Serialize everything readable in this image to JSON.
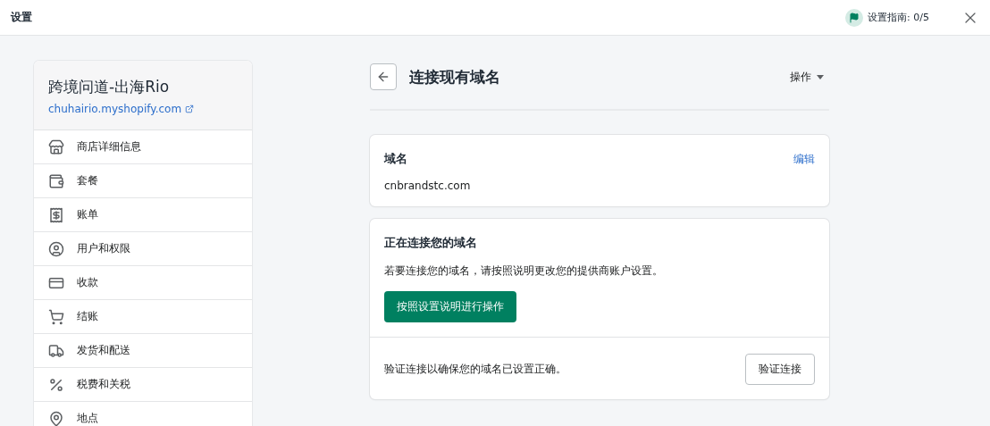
{
  "top_bar": {
    "title": "设置",
    "setup_guide": "设置指南: 0/5"
  },
  "sidebar": {
    "store_name": "跨境问道-出海Rio",
    "store_url": "chuhairio.myshopify.com",
    "items": [
      {
        "kind": "store",
        "label": "商店详细信息"
      },
      {
        "kind": "plan",
        "label": "套餐"
      },
      {
        "kind": "billing",
        "label": "账单"
      },
      {
        "kind": "users",
        "label": "用户和权限"
      },
      {
        "kind": "payments",
        "label": "收款"
      },
      {
        "kind": "checkout",
        "label": "结账"
      },
      {
        "kind": "shipping",
        "label": "发货和配送"
      },
      {
        "kind": "taxes",
        "label": "税费和关税"
      },
      {
        "kind": "locations",
        "label": "地点"
      }
    ]
  },
  "page": {
    "title": "连接现有域名",
    "actions": "操作"
  },
  "domain_card": {
    "title": "域名",
    "edit": "编辑",
    "domain": "cnbrandstc.com"
  },
  "connect_card": {
    "title": "正在连接您的域名",
    "description": "若要连接您的域名，请按照说明更改您的提供商账户设置。",
    "primary_button": "按照设置说明进行操作",
    "verify_text": "验证连接以确保您的域名已设置正确。",
    "verify_button": "验证连接"
  }
}
